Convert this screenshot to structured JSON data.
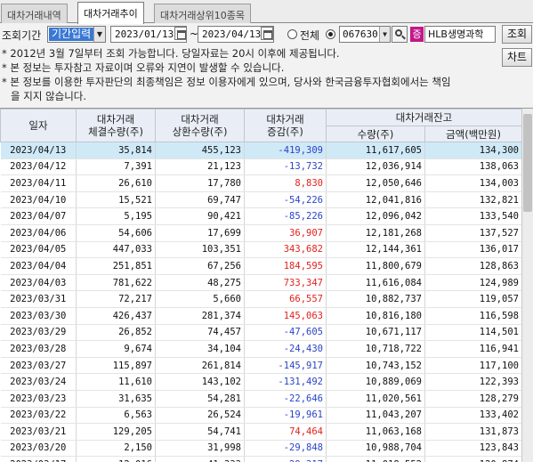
{
  "tabs": [
    "대차거래내역",
    "대차거래추이",
    "대차거래상위10종목"
  ],
  "query": {
    "period_label": "조회기간",
    "period_value": "기간입력",
    "start_date": "2023/01/13",
    "tilde": "~",
    "end_date": "2023/04/13",
    "scope_all": "전체",
    "stock_code": "067630",
    "stock_badge": "증",
    "stock_name": "HLB생명과학",
    "search_button": "조회",
    "chart_button": "차트"
  },
  "notices": [
    "* 2012년 3월 7일부터 조회 가능합니다. 당일자료는 20시 이후에 제공됩니다.",
    "* 본 정보는 투자참고 자료이며 오류와 지연이 발생할 수 있습니다.",
    "* 본 정보를 이용한 투자판단의 최종책임은 정보 이용자에게 있으며, 당사와 한국금융투자협회에서는 책임",
    "을 지지 않습니다."
  ],
  "table": {
    "headers": {
      "date": "일자",
      "settle_1": "대차거래",
      "settle_2": "체결수량(주)",
      "repay_1": "대차거래",
      "repay_2": "상환수량(주)",
      "change_1": "대차거래",
      "change_2": "증감(주)",
      "balance": "대차거래잔고",
      "qty": "수량(주)",
      "amount": "금액(백만원)"
    },
    "rows": [
      {
        "date": "2023/04/13",
        "settle": "35,814",
        "repay": "455,123",
        "change": "-419,309",
        "sign": "neg",
        "qty": "11,617,605",
        "amount": "134,300"
      },
      {
        "date": "2023/04/12",
        "settle": "7,391",
        "repay": "21,123",
        "change": "-13,732",
        "sign": "neg",
        "qty": "12,036,914",
        "amount": "138,063"
      },
      {
        "date": "2023/04/11",
        "settle": "26,610",
        "repay": "17,780",
        "change": "8,830",
        "sign": "pos",
        "qty": "12,050,646",
        "amount": "134,003"
      },
      {
        "date": "2023/04/10",
        "settle": "15,521",
        "repay": "69,747",
        "change": "-54,226",
        "sign": "neg",
        "qty": "12,041,816",
        "amount": "132,821"
      },
      {
        "date": "2023/04/07",
        "settle": "5,195",
        "repay": "90,421",
        "change": "-85,226",
        "sign": "neg",
        "qty": "12,096,042",
        "amount": "133,540"
      },
      {
        "date": "2023/04/06",
        "settle": "54,606",
        "repay": "17,699",
        "change": "36,907",
        "sign": "pos",
        "qty": "12,181,268",
        "amount": "137,527"
      },
      {
        "date": "2023/04/05",
        "settle": "447,033",
        "repay": "103,351",
        "change": "343,682",
        "sign": "pos",
        "qty": "12,144,361",
        "amount": "136,017"
      },
      {
        "date": "2023/04/04",
        "settle": "251,851",
        "repay": "67,256",
        "change": "184,595",
        "sign": "pos",
        "qty": "11,800,679",
        "amount": "128,863"
      },
      {
        "date": "2023/04/03",
        "settle": "781,622",
        "repay": "48,275",
        "change": "733,347",
        "sign": "pos",
        "qty": "11,616,084",
        "amount": "124,989"
      },
      {
        "date": "2023/03/31",
        "settle": "72,217",
        "repay": "5,660",
        "change": "66,557",
        "sign": "pos",
        "qty": "10,882,737",
        "amount": "119,057"
      },
      {
        "date": "2023/03/30",
        "settle": "426,437",
        "repay": "281,374",
        "change": "145,063",
        "sign": "pos",
        "qty": "10,816,180",
        "amount": "116,598"
      },
      {
        "date": "2023/03/29",
        "settle": "26,852",
        "repay": "74,457",
        "change": "-47,605",
        "sign": "neg",
        "qty": "10,671,117",
        "amount": "114,501"
      },
      {
        "date": "2023/03/28",
        "settle": "9,674",
        "repay": "34,104",
        "change": "-24,430",
        "sign": "neg",
        "qty": "10,718,722",
        "amount": "116,941"
      },
      {
        "date": "2023/03/27",
        "settle": "115,897",
        "repay": "261,814",
        "change": "-145,917",
        "sign": "neg",
        "qty": "10,743,152",
        "amount": "117,100"
      },
      {
        "date": "2023/03/24",
        "settle": "11,610",
        "repay": "143,102",
        "change": "-131,492",
        "sign": "neg",
        "qty": "10,889,069",
        "amount": "122,393"
      },
      {
        "date": "2023/03/23",
        "settle": "31,635",
        "repay": "54,281",
        "change": "-22,646",
        "sign": "neg",
        "qty": "11,020,561",
        "amount": "128,279"
      },
      {
        "date": "2023/03/22",
        "settle": "6,563",
        "repay": "26,524",
        "change": "-19,961",
        "sign": "neg",
        "qty": "11,043,207",
        "amount": "133,402"
      },
      {
        "date": "2023/03/21",
        "settle": "129,205",
        "repay": "54,741",
        "change": "74,464",
        "sign": "pos",
        "qty": "11,063,168",
        "amount": "131,873"
      },
      {
        "date": "2023/03/20",
        "settle": "2,150",
        "repay": "31,998",
        "change": "-29,848",
        "sign": "neg",
        "qty": "10,988,704",
        "amount": "123,843"
      },
      {
        "date": "2023/03/17",
        "settle": "12,016",
        "repay": "41,333",
        "change": "-29,317",
        "sign": "neg",
        "qty": "11,018,552",
        "amount": "120,874"
      }
    ]
  },
  "colors": {
    "negative": "#2a43c7",
    "positive": "#e0221c",
    "selected_row": "#cfe9f7",
    "period_highlight": "#3a78d4",
    "stock_badge": "#c2188a"
  }
}
